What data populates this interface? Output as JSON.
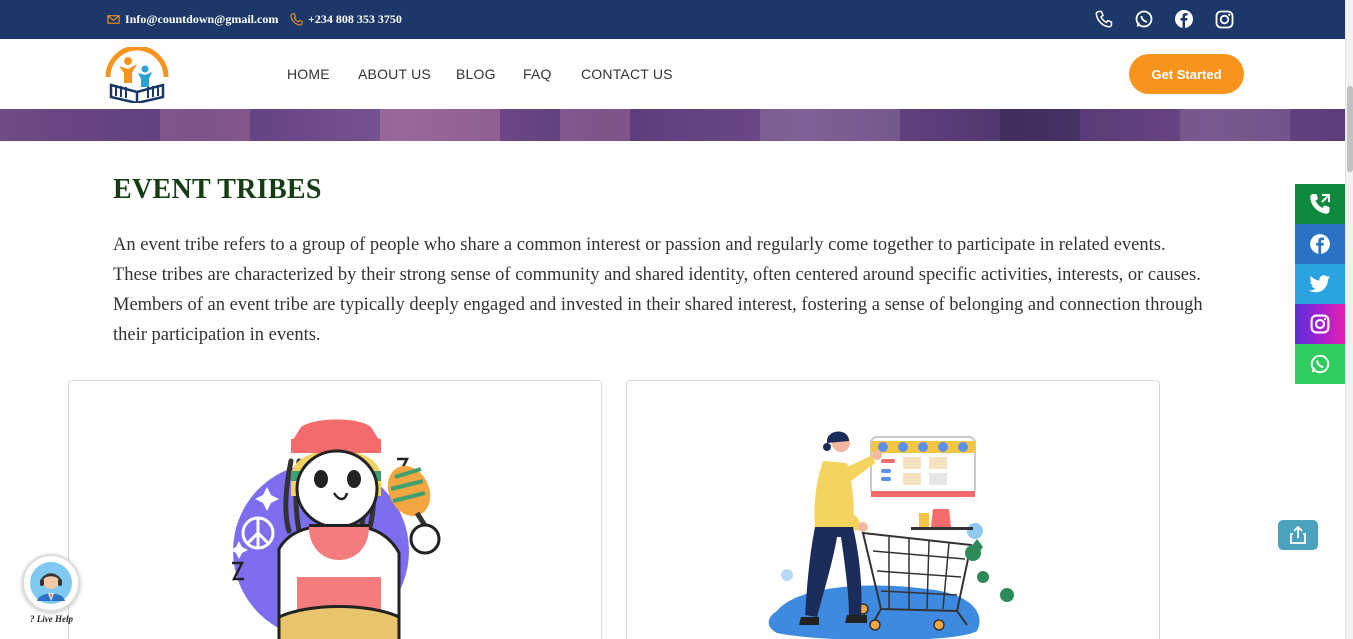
{
  "topbar": {
    "email": "Info@countdown@gmail.com",
    "phone": "+234 808 353 3750",
    "social_icons": [
      "phone-icon",
      "whatsapp-icon",
      "facebook-icon",
      "instagram-icon"
    ]
  },
  "nav": {
    "items": [
      "HOME",
      "ABOUT US",
      "BLOG",
      "FAQ",
      "CONTACT US"
    ],
    "cta": "Get Started"
  },
  "content": {
    "title": "EVENT TRIBES",
    "description": "An event tribe refers to a group of people who share a common interest or passion and regularly come together to participate in related events. These tribes are characterized by their strong sense of community and shared identity, often centered around specific activities, interests, or causes. Members of an event tribe are typically deeply engaged and invested in their shared interest, fostering a sense of belonging and connection through their participation in events."
  },
  "float_bar": {
    "buttons": [
      {
        "icon": "phone-call-icon",
        "color": "#0e8a3e"
      },
      {
        "icon": "facebook-icon",
        "color": "#2a73c4"
      },
      {
        "icon": "twitter-icon",
        "color": "#2ba3e0"
      },
      {
        "icon": "instagram-icon",
        "color": "#8a2be2"
      },
      {
        "icon": "whatsapp-icon",
        "color": "#2fcc5f"
      }
    ]
  },
  "live_help": {
    "label": "? Live Help"
  },
  "colors": {
    "topbar": "#1c3869",
    "accent": "#f7941d",
    "title": "#143d14"
  }
}
